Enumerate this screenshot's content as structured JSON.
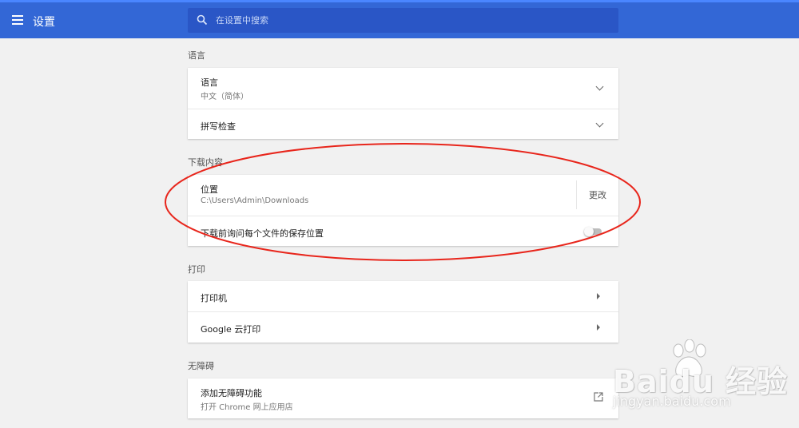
{
  "header": {
    "title": "设置",
    "search_placeholder": "在设置中搜索"
  },
  "sections": {
    "language": {
      "title": "语言",
      "language_label": "语言",
      "language_value": "中文（简体）",
      "spellcheck_label": "拼写检查"
    },
    "downloads": {
      "title": "下载内容",
      "location_label": "位置",
      "location_value": "C:\\Users\\Admin\\Downloads",
      "change_label": "更改",
      "ask_label": "下载前询问每个文件的保存位置",
      "ask_enabled": false
    },
    "printing": {
      "title": "打印",
      "printers_label": "打印机",
      "cloud_print_label": "Google 云打印"
    },
    "accessibility": {
      "title": "无障碍",
      "add_label": "添加无障碍功能",
      "add_sub": "打开 Chrome 网上应用店"
    }
  },
  "watermark": {
    "brand": "Baidu 经验",
    "url": "jingyan.baidu.com"
  },
  "colors": {
    "header_bg": "#3367d6",
    "search_bg": "#2a56c6",
    "annotation": "#e8261c"
  },
  "icons": {
    "menu": "menu-icon",
    "search": "search-icon",
    "expand": "chevron-down-icon",
    "navigate": "arrow-right-icon",
    "external": "open-external-icon"
  }
}
